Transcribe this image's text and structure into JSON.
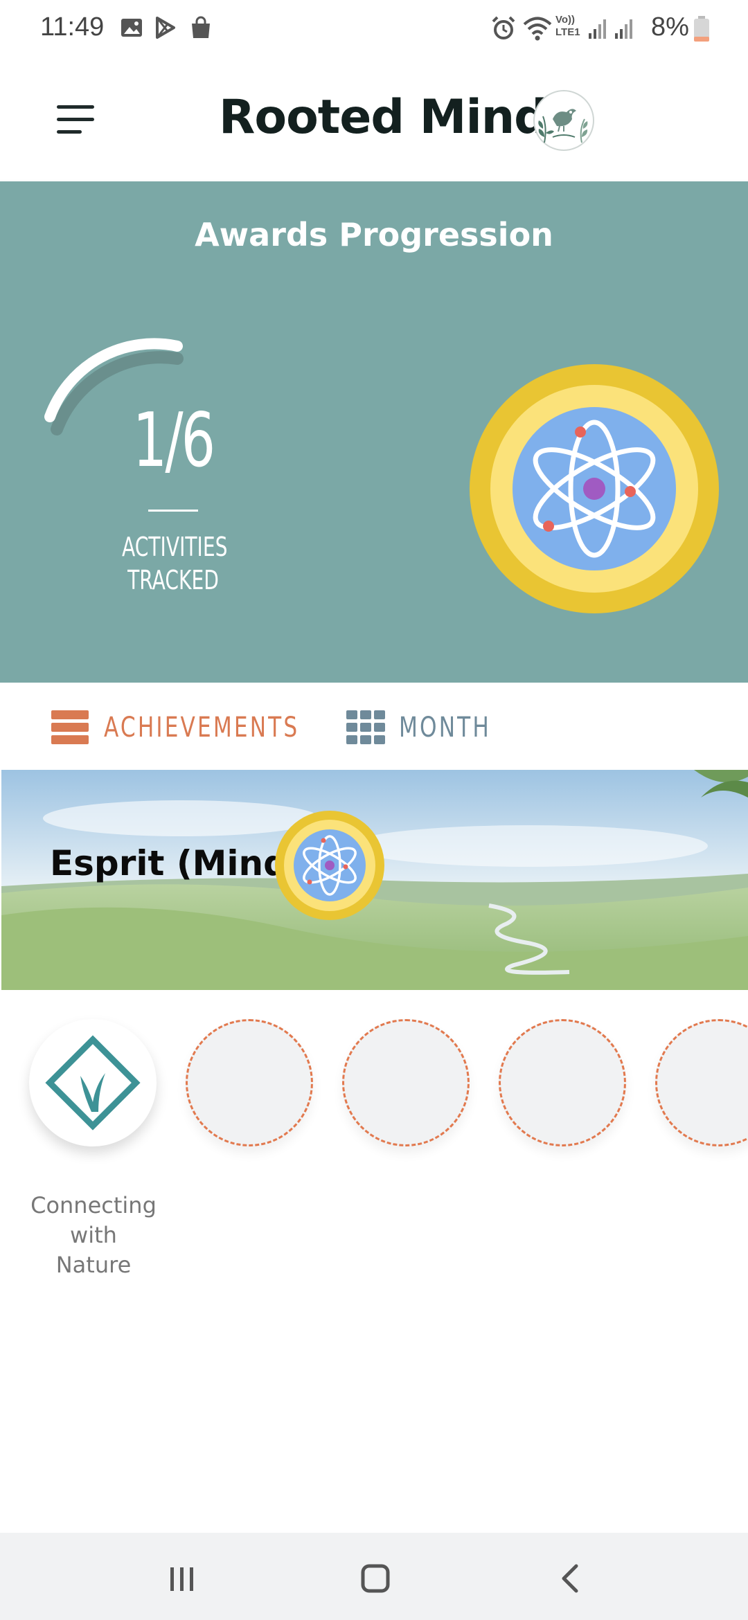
{
  "status_bar": {
    "time": "11:49",
    "battery": "8%",
    "left_icons": [
      "image-icon",
      "play-store-icon",
      "shopping-bag-icon"
    ],
    "right_icons": [
      "alarm-icon",
      "wifi-icon",
      "volte-icon",
      "signal-icon",
      "battery-icon"
    ],
    "volte_label": "Vo)) LTE1"
  },
  "header": {
    "title": "Rooted Minds",
    "logo": "bird-leaf-logo"
  },
  "awards": {
    "title": "Awards Progression",
    "tracked": "1/6",
    "caption": "ACTIVITIES TRACKED",
    "progress_fraction": 0.1667,
    "badge_icon": "atom-icon"
  },
  "tabs": {
    "achievements": "ACHIEVEMENTS",
    "month": "MONTH",
    "selected": "achievements"
  },
  "category": {
    "title": "Esprit (Mind)",
    "badge_icon": "atom-icon"
  },
  "activities": [
    {
      "label": "Connecting with Nature",
      "completed": true,
      "icon": "grass-diamond-icon"
    },
    {
      "label": "",
      "completed": false
    },
    {
      "label": "",
      "completed": false
    },
    {
      "label": "",
      "completed": false
    },
    {
      "label": "",
      "completed": false
    }
  ],
  "colors": {
    "teal": "#7ba8a6",
    "accent_orange": "#d97a52",
    "badge_gold": "#e9c533",
    "badge_blue": "#7fb0ec"
  }
}
